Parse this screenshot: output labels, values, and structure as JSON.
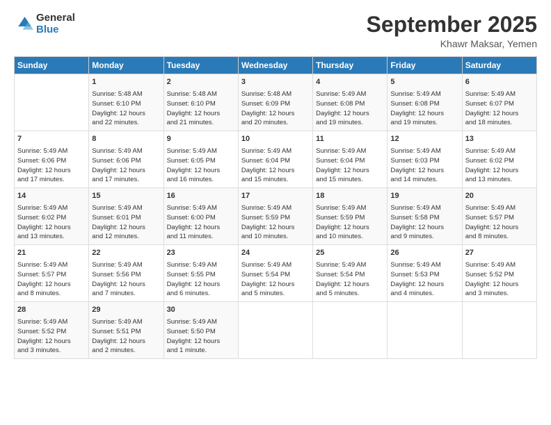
{
  "header": {
    "logo_general": "General",
    "logo_blue": "Blue",
    "month_title": "September 2025",
    "location": "Khawr Maksar, Yemen"
  },
  "days_of_week": [
    "Sunday",
    "Monday",
    "Tuesday",
    "Wednesday",
    "Thursday",
    "Friday",
    "Saturday"
  ],
  "weeks": [
    [
      {
        "day": "",
        "content": ""
      },
      {
        "day": "1",
        "content": "Sunrise: 5:48 AM\nSunset: 6:10 PM\nDaylight: 12 hours\nand 22 minutes."
      },
      {
        "day": "2",
        "content": "Sunrise: 5:48 AM\nSunset: 6:10 PM\nDaylight: 12 hours\nand 21 minutes."
      },
      {
        "day": "3",
        "content": "Sunrise: 5:48 AM\nSunset: 6:09 PM\nDaylight: 12 hours\nand 20 minutes."
      },
      {
        "day": "4",
        "content": "Sunrise: 5:49 AM\nSunset: 6:08 PM\nDaylight: 12 hours\nand 19 minutes."
      },
      {
        "day": "5",
        "content": "Sunrise: 5:49 AM\nSunset: 6:08 PM\nDaylight: 12 hours\nand 19 minutes."
      },
      {
        "day": "6",
        "content": "Sunrise: 5:49 AM\nSunset: 6:07 PM\nDaylight: 12 hours\nand 18 minutes."
      }
    ],
    [
      {
        "day": "7",
        "content": "Sunrise: 5:49 AM\nSunset: 6:06 PM\nDaylight: 12 hours\nand 17 minutes."
      },
      {
        "day": "8",
        "content": "Sunrise: 5:49 AM\nSunset: 6:06 PM\nDaylight: 12 hours\nand 17 minutes."
      },
      {
        "day": "9",
        "content": "Sunrise: 5:49 AM\nSunset: 6:05 PM\nDaylight: 12 hours\nand 16 minutes."
      },
      {
        "day": "10",
        "content": "Sunrise: 5:49 AM\nSunset: 6:04 PM\nDaylight: 12 hours\nand 15 minutes."
      },
      {
        "day": "11",
        "content": "Sunrise: 5:49 AM\nSunset: 6:04 PM\nDaylight: 12 hours\nand 15 minutes."
      },
      {
        "day": "12",
        "content": "Sunrise: 5:49 AM\nSunset: 6:03 PM\nDaylight: 12 hours\nand 14 minutes."
      },
      {
        "day": "13",
        "content": "Sunrise: 5:49 AM\nSunset: 6:02 PM\nDaylight: 12 hours\nand 13 minutes."
      }
    ],
    [
      {
        "day": "14",
        "content": "Sunrise: 5:49 AM\nSunset: 6:02 PM\nDaylight: 12 hours\nand 13 minutes."
      },
      {
        "day": "15",
        "content": "Sunrise: 5:49 AM\nSunset: 6:01 PM\nDaylight: 12 hours\nand 12 minutes."
      },
      {
        "day": "16",
        "content": "Sunrise: 5:49 AM\nSunset: 6:00 PM\nDaylight: 12 hours\nand 11 minutes."
      },
      {
        "day": "17",
        "content": "Sunrise: 5:49 AM\nSunset: 5:59 PM\nDaylight: 12 hours\nand 10 minutes."
      },
      {
        "day": "18",
        "content": "Sunrise: 5:49 AM\nSunset: 5:59 PM\nDaylight: 12 hours\nand 10 minutes."
      },
      {
        "day": "19",
        "content": "Sunrise: 5:49 AM\nSunset: 5:58 PM\nDaylight: 12 hours\nand 9 minutes."
      },
      {
        "day": "20",
        "content": "Sunrise: 5:49 AM\nSunset: 5:57 PM\nDaylight: 12 hours\nand 8 minutes."
      }
    ],
    [
      {
        "day": "21",
        "content": "Sunrise: 5:49 AM\nSunset: 5:57 PM\nDaylight: 12 hours\nand 8 minutes."
      },
      {
        "day": "22",
        "content": "Sunrise: 5:49 AM\nSunset: 5:56 PM\nDaylight: 12 hours\nand 7 minutes."
      },
      {
        "day": "23",
        "content": "Sunrise: 5:49 AM\nSunset: 5:55 PM\nDaylight: 12 hours\nand 6 minutes."
      },
      {
        "day": "24",
        "content": "Sunrise: 5:49 AM\nSunset: 5:54 PM\nDaylight: 12 hours\nand 5 minutes."
      },
      {
        "day": "25",
        "content": "Sunrise: 5:49 AM\nSunset: 5:54 PM\nDaylight: 12 hours\nand 5 minutes."
      },
      {
        "day": "26",
        "content": "Sunrise: 5:49 AM\nSunset: 5:53 PM\nDaylight: 12 hours\nand 4 minutes."
      },
      {
        "day": "27",
        "content": "Sunrise: 5:49 AM\nSunset: 5:52 PM\nDaylight: 12 hours\nand 3 minutes."
      }
    ],
    [
      {
        "day": "28",
        "content": "Sunrise: 5:49 AM\nSunset: 5:52 PM\nDaylight: 12 hours\nand 3 minutes."
      },
      {
        "day": "29",
        "content": "Sunrise: 5:49 AM\nSunset: 5:51 PM\nDaylight: 12 hours\nand 2 minutes."
      },
      {
        "day": "30",
        "content": "Sunrise: 5:49 AM\nSunset: 5:50 PM\nDaylight: 12 hours\nand 1 minute."
      },
      {
        "day": "",
        "content": ""
      },
      {
        "day": "",
        "content": ""
      },
      {
        "day": "",
        "content": ""
      },
      {
        "day": "",
        "content": ""
      }
    ]
  ]
}
